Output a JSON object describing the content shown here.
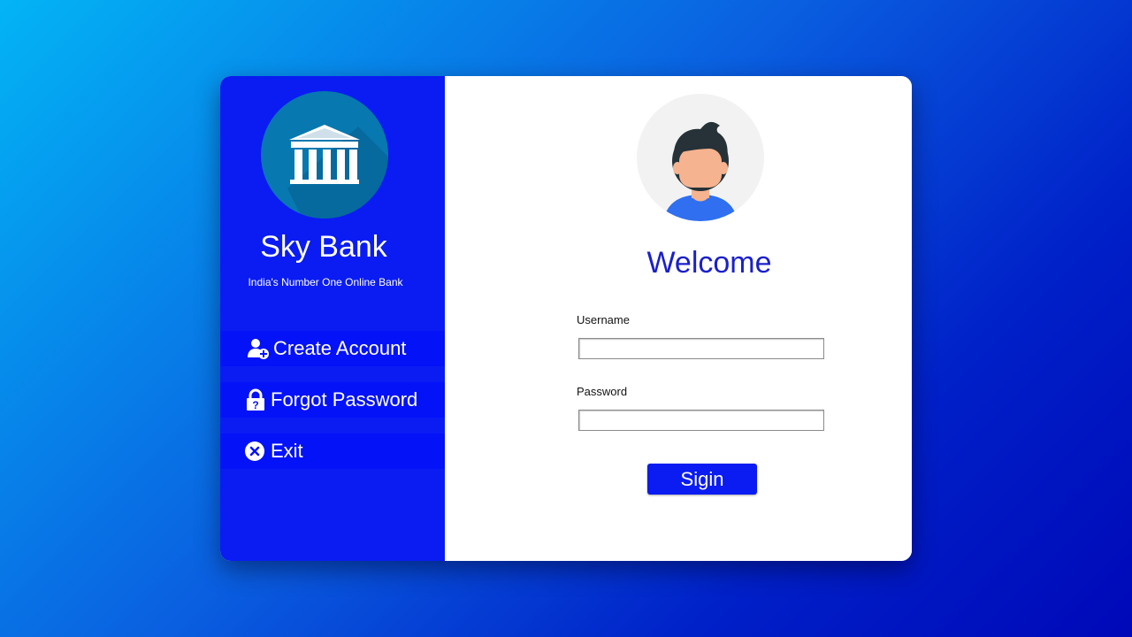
{
  "sidebar": {
    "brand_name": "Sky Bank",
    "tagline": "India's Number One Online Bank",
    "logo_icon": "bank-building-icon",
    "items": [
      {
        "label": "Create Account",
        "icon": "add-user-icon"
      },
      {
        "label": "Forgot  Password",
        "icon": "lock-question-icon"
      },
      {
        "label": "Exit",
        "icon": "close-circle-icon"
      }
    ]
  },
  "main": {
    "avatar_icon": "user-avatar-icon",
    "welcome": "Welcome",
    "username_label": "Username",
    "username_value": "",
    "password_label": "Password",
    "password_value": "",
    "signin_label": "Sigin"
  },
  "colors": {
    "sidebar": "#0a1cf2",
    "nav_item": "#0412f8",
    "welcome_text": "#1a1fcc",
    "button": "#0a1cf2",
    "logo_circle": "#0878b0"
  }
}
